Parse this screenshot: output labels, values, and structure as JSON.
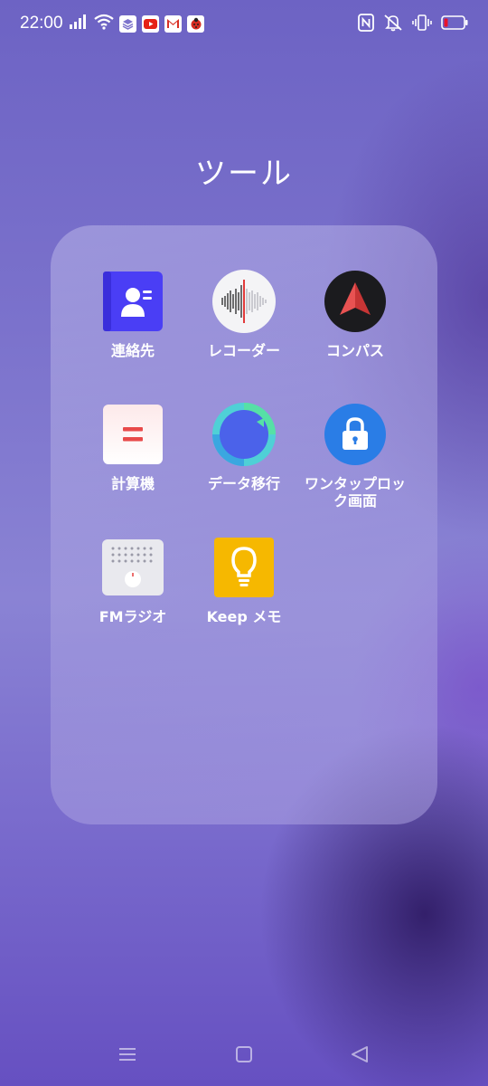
{
  "status_bar": {
    "time": "22:00",
    "notification_icons": [
      "stack-icon",
      "youtube-icon",
      "gmail-icon",
      "ladybug-icon"
    ],
    "right_icons": [
      "nfc-icon",
      "muted-bell-icon",
      "vibrate-icon",
      "battery-low-icon"
    ]
  },
  "folder": {
    "title": "ツール",
    "apps": [
      {
        "label": "連絡先",
        "icon": "contacts-icon"
      },
      {
        "label": "レコーダー",
        "icon": "recorder-icon"
      },
      {
        "label": "コンパス",
        "icon": "compass-icon"
      },
      {
        "label": "計算機",
        "icon": "calculator-icon"
      },
      {
        "label": "データ移行",
        "icon": "data-transfer-icon"
      },
      {
        "label": "ワンタップロック画面",
        "icon": "lock-icon"
      },
      {
        "label": "FMラジオ",
        "icon": "radio-icon"
      },
      {
        "label": "Keep メモ",
        "icon": "keep-icon"
      }
    ]
  },
  "nav_bar": {
    "buttons": [
      "menu-icon",
      "home-icon",
      "back-icon"
    ]
  },
  "colors": {
    "contacts": "#4a3ef5",
    "compass_arrow": "#e04848",
    "lock": "#2a7de6",
    "keep": "#f6b800",
    "calculator_equals": "#e84a4a"
  }
}
